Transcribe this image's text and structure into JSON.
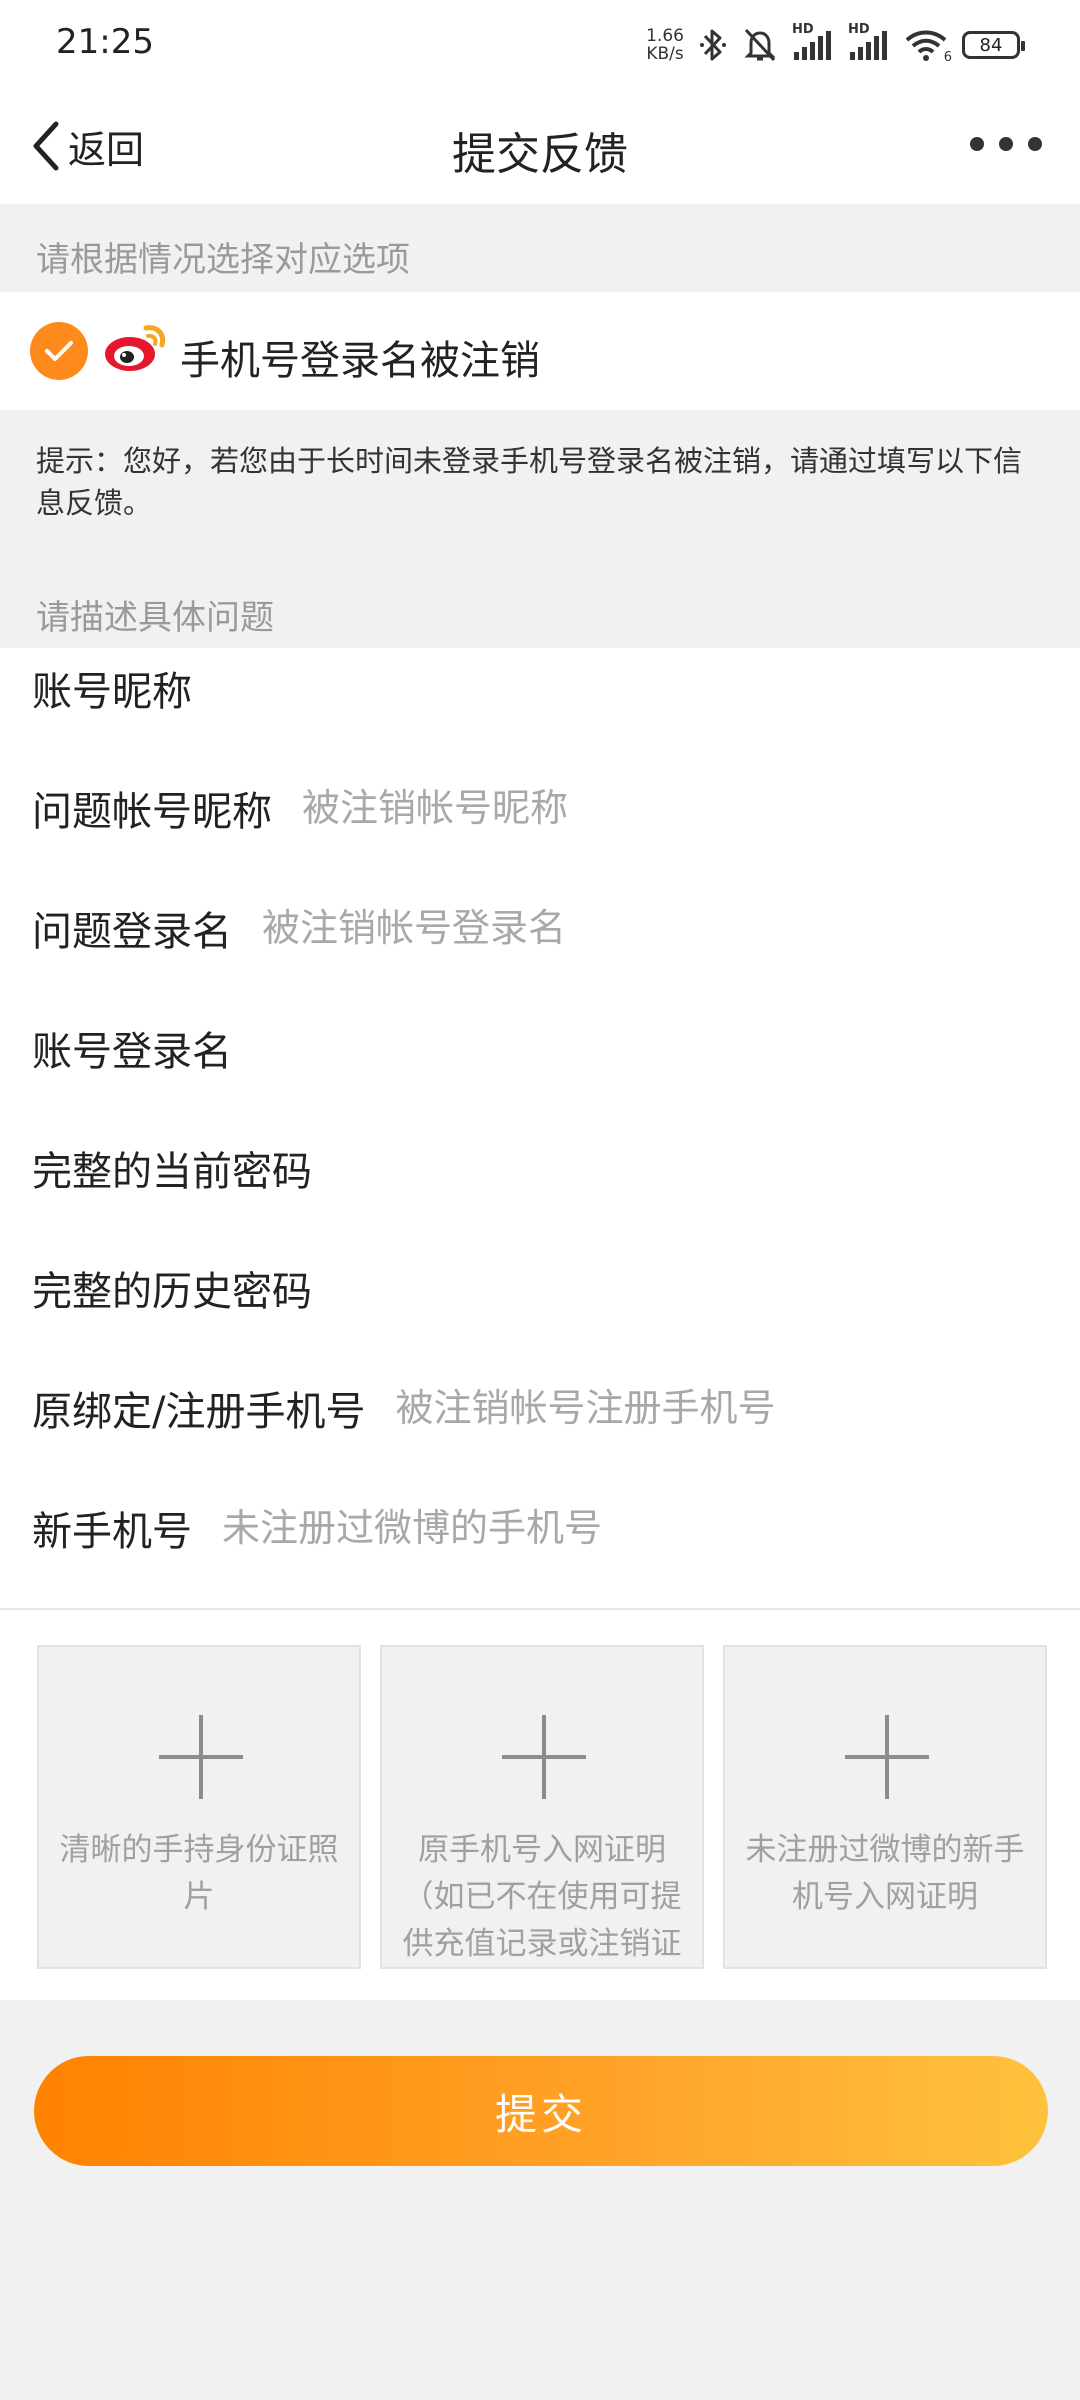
{
  "status_bar": {
    "time": "21:25",
    "net_speed_value": "1.66",
    "net_speed_unit": "KB/s",
    "hd1": "HD",
    "hd2": "HD",
    "wifi_sub": "6",
    "battery": "84"
  },
  "nav": {
    "back_label": "返回",
    "title": "提交反馈"
  },
  "section_select": "请根据情况选择对应选项",
  "option": {
    "label": "手机号登录名被注销",
    "checked": true
  },
  "hint": "提示：您好，若您由于长时间未登录手机号登录名被注销，请通过填写以下信息反馈。",
  "section_describe": "请描述具体问题",
  "fields": [
    {
      "label": "账号昵称",
      "placeholder": ""
    },
    {
      "label": "问题帐号昵称",
      "placeholder": "被注销帐号昵称"
    },
    {
      "label": "问题登录名",
      "placeholder": "被注销帐号登录名"
    },
    {
      "label": "账号登录名",
      "placeholder": ""
    },
    {
      "label": "完整的当前密码",
      "placeholder": ""
    },
    {
      "label": "完整的历史密码",
      "placeholder": ""
    },
    {
      "label": "原绑定/注册手机号",
      "placeholder": "被注销帐号注册手机号"
    },
    {
      "label": "新手机号",
      "placeholder": "未注册过微博的手机号"
    }
  ],
  "uploads": [
    {
      "text": "清晰的手持身份证照片"
    },
    {
      "text": "原手机号入网证明（如已不在使用可提供充值记录或注销证明）"
    },
    {
      "text": "未注册过微博的新手机号入网证明"
    }
  ],
  "submit_label": "提交",
  "colors": {
    "accent": "#ff8a1c",
    "button_start": "#ff8200",
    "button_end": "#ffc23c"
  }
}
